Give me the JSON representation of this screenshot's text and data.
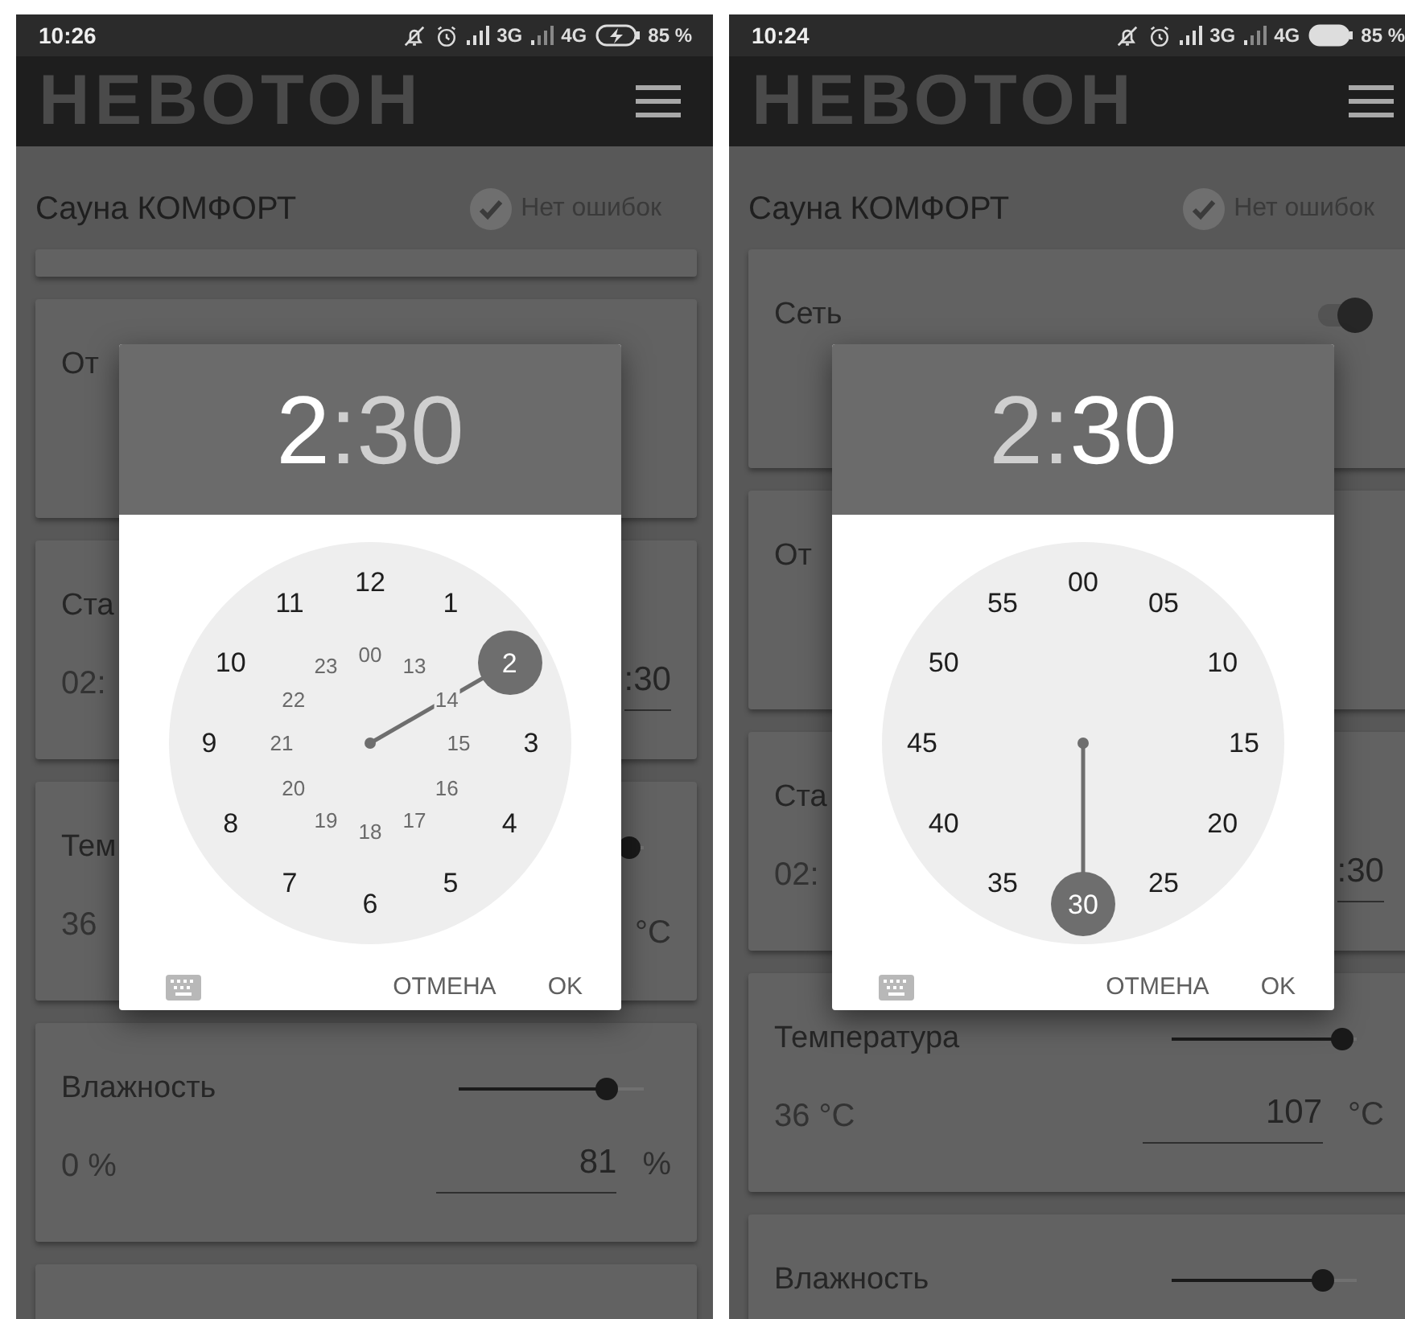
{
  "phones": [
    {
      "status_bar": {
        "time": "10:26",
        "network_1": "3G",
        "network_2": "4G",
        "charging": true,
        "battery": "85 %"
      },
      "app_bar": {
        "logo": "НЕВОТОН"
      },
      "header": {
        "title": "Сауна КОМФОРТ",
        "status": "Нет ошибок"
      },
      "cards": [
        {
          "kind": "strip"
        },
        {
          "kind": "panel",
          "title": "От"
        },
        {
          "kind": "panel",
          "title": "Ста",
          "reading": "02:",
          "field_value": ":30"
        },
        {
          "kind": "panel",
          "title": "Тем",
          "slider": {
            "level": 0.92
          },
          "reading": "36",
          "unit": "°C"
        },
        {
          "kind": "panel",
          "title": "Влажность",
          "slider": {
            "level": 0.8
          },
          "reading": "0 %",
          "field_value": "81",
          "unit": "%"
        },
        {
          "kind": "panel"
        }
      ],
      "dialog": {
        "hour": {
          "text": "2",
          "selected": true
        },
        "separator": ":",
        "minute": {
          "text": "30",
          "selected": false
        },
        "outer": [
          {
            "label": "12",
            "selected": false
          },
          {
            "label": "1",
            "selected": false
          },
          {
            "label": "2",
            "selected": true
          },
          {
            "label": "3",
            "selected": false
          },
          {
            "label": "4",
            "selected": false
          },
          {
            "label": "5",
            "selected": false
          },
          {
            "label": "6",
            "selected": false
          },
          {
            "label": "7",
            "selected": false
          },
          {
            "label": "8",
            "selected": false
          },
          {
            "label": "9",
            "selected": false
          },
          {
            "label": "10",
            "selected": false
          },
          {
            "label": "11",
            "selected": false
          }
        ],
        "inner": [
          {
            "label": "00",
            "selected": false
          },
          {
            "label": "13",
            "selected": false
          },
          {
            "label": "14",
            "selected": false
          },
          {
            "label": "15",
            "selected": false
          },
          {
            "label": "16",
            "selected": false
          },
          {
            "label": "17",
            "selected": false
          },
          {
            "label": "18",
            "selected": false
          },
          {
            "label": "19",
            "selected": false
          },
          {
            "label": "20",
            "selected": false
          },
          {
            "label": "21",
            "selected": false
          },
          {
            "label": "22",
            "selected": false
          },
          {
            "label": "23",
            "selected": false
          }
        ],
        "buttons": [
          "ОТМЕНА",
          "OK"
        ]
      }
    },
    {
      "status_bar": {
        "time": "10:24",
        "network_1": "3G",
        "network_2": "4G",
        "charging": false,
        "battery": "85 %"
      },
      "app_bar": {
        "logo": "НЕВОТОН"
      },
      "header": {
        "title": "Сауна КОМФОРТ",
        "status": "Нет ошибок"
      },
      "cards": [
        {
          "kind": "panel",
          "title": "Сеть",
          "toggle": {
            "on": true
          }
        },
        {
          "kind": "panel",
          "title": "От"
        },
        {
          "kind": "panel",
          "title": "Ста",
          "reading": "02:",
          "field_value": ":30"
        },
        {
          "kind": "panel",
          "title": "Температура",
          "slider": {
            "level": 0.92
          },
          "reading": "36 °C",
          "field_value": "107",
          "unit": "°C"
        },
        {
          "kind": "panel",
          "title": "Влажность",
          "slider": {
            "level": 0.82
          }
        }
      ],
      "dialog": {
        "hour": {
          "text": "2",
          "selected": false
        },
        "separator": ":",
        "minute": {
          "text": "30",
          "selected": true
        },
        "outer": [
          {
            "label": "00",
            "selected": false
          },
          {
            "label": "05",
            "selected": false
          },
          {
            "label": "10",
            "selected": false
          },
          {
            "label": "15",
            "selected": false
          },
          {
            "label": "20",
            "selected": false
          },
          {
            "label": "25",
            "selected": false
          },
          {
            "label": "30",
            "selected": true
          },
          {
            "label": "35",
            "selected": false
          },
          {
            "label": "40",
            "selected": false
          },
          {
            "label": "45",
            "selected": false
          },
          {
            "label": "50",
            "selected": false
          },
          {
            "label": "55",
            "selected": false
          }
        ],
        "buttons": [
          "ОТМЕНА",
          "OK"
        ]
      }
    }
  ]
}
